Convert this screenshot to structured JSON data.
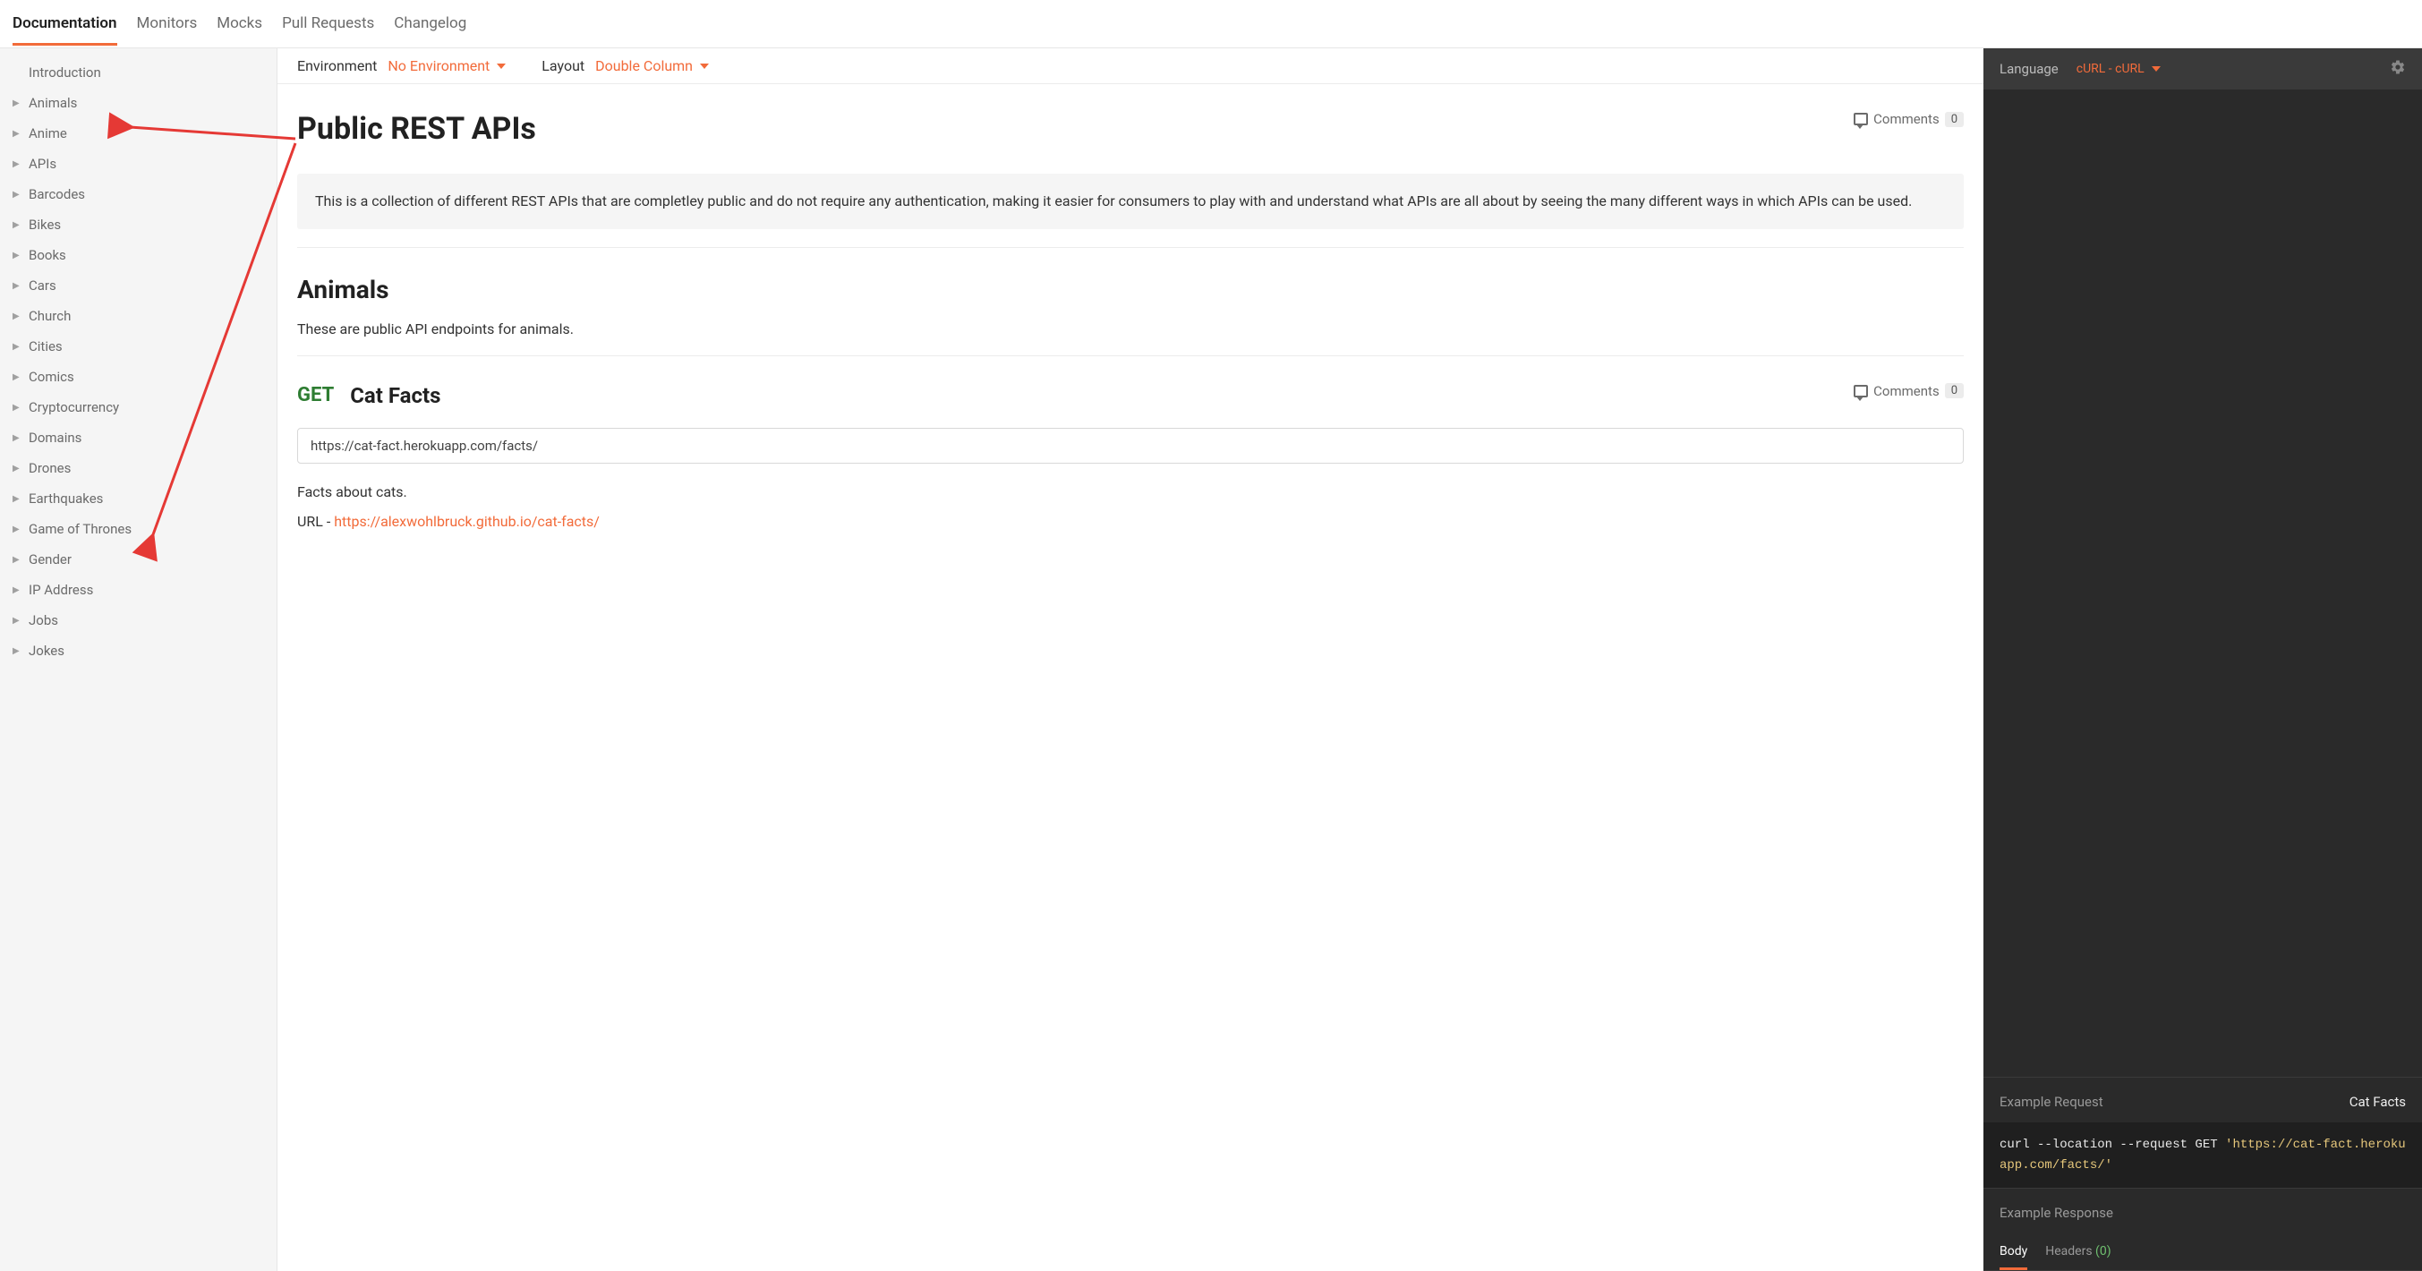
{
  "topnav": {
    "items": [
      "Documentation",
      "Monitors",
      "Mocks",
      "Pull Requests",
      "Changelog"
    ],
    "activeIndex": 0
  },
  "sidebar": {
    "items": [
      {
        "label": "Introduction",
        "hasChildren": false
      },
      {
        "label": "Animals",
        "hasChildren": true
      },
      {
        "label": "Anime",
        "hasChildren": true
      },
      {
        "label": "APIs",
        "hasChildren": true
      },
      {
        "label": "Barcodes",
        "hasChildren": true
      },
      {
        "label": "Bikes",
        "hasChildren": true
      },
      {
        "label": "Books",
        "hasChildren": true
      },
      {
        "label": "Cars",
        "hasChildren": true
      },
      {
        "label": "Church",
        "hasChildren": true
      },
      {
        "label": "Cities",
        "hasChildren": true
      },
      {
        "label": "Comics",
        "hasChildren": true
      },
      {
        "label": "Cryptocurrency",
        "hasChildren": true
      },
      {
        "label": "Domains",
        "hasChildren": true
      },
      {
        "label": "Drones",
        "hasChildren": true
      },
      {
        "label": "Earthquakes",
        "hasChildren": true
      },
      {
        "label": "Game of Thrones",
        "hasChildren": true
      },
      {
        "label": "Gender",
        "hasChildren": true
      },
      {
        "label": "IP Address",
        "hasChildren": true
      },
      {
        "label": "Jobs",
        "hasChildren": true
      },
      {
        "label": "Jokes",
        "hasChildren": true
      }
    ]
  },
  "toolbar": {
    "environment_label": "Environment",
    "environment_value": "No Environment",
    "layout_label": "Layout",
    "layout_value": "Double Column"
  },
  "content": {
    "page_title": "Public REST APIs",
    "comments_label": "Comments",
    "comments_count": "0",
    "description": "This is a collection of different REST APIs that are completley public and do not require any authentication, making it easier for consumers to play with and understand what APIs are all about by seeing the many different ways in which APIs can be used.",
    "section1_title": "Animals",
    "section1_desc": "These are public API endpoints for animals.",
    "endpoint": {
      "method": "GET",
      "name": "Cat Facts",
      "comments_count": "0",
      "url": "https://cat-fact.herokuapp.com/facts/",
      "desc": "Facts about cats.",
      "url_line_prefix": "URL - ",
      "url_line_link": "https://alexwohlbruck.github.io/cat-facts/"
    }
  },
  "right": {
    "language_label": "Language",
    "language_value": "cURL - cURL",
    "example_request_label": "Example Request",
    "example_request_name": "Cat Facts",
    "code_prefix": "curl --location --request GET ",
    "code_url": "'https://cat-fact.herokuapp.com/facts/'",
    "example_response_label": "Example Response",
    "tabs": {
      "body": "Body",
      "headers": "Headers",
      "headers_count": "(0)"
    }
  }
}
